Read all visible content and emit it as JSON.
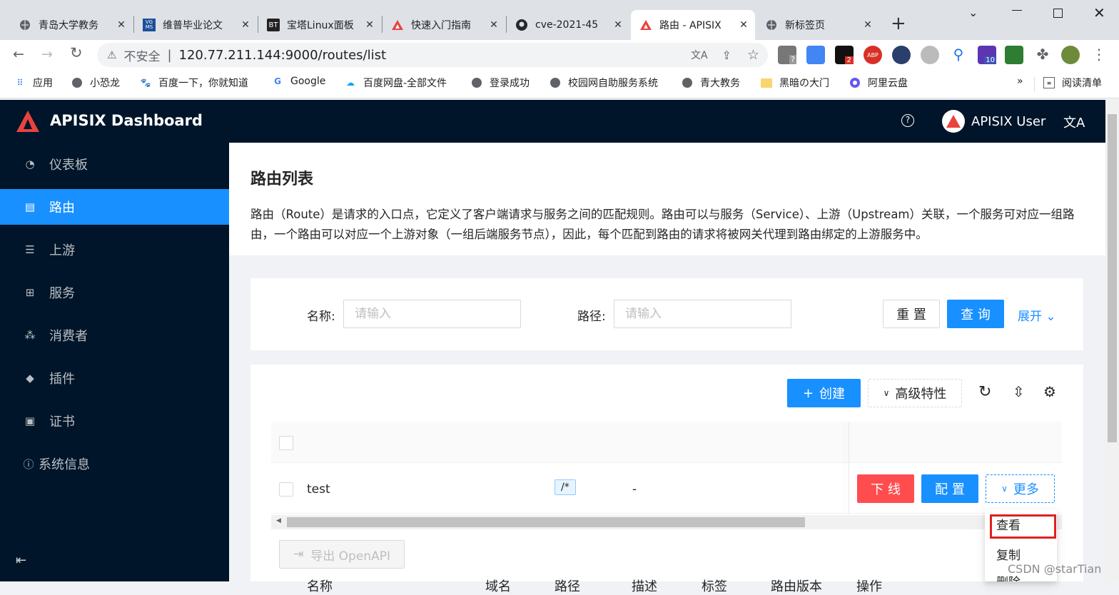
{
  "browser": {
    "tabs": [
      {
        "title": "青岛大学教务",
        "icon": "globe-icon"
      },
      {
        "title": "维普毕业论文",
        "icon": "vgms-icon"
      },
      {
        "title": "宝塔Linux面板",
        "icon": "bt-icon"
      },
      {
        "title": "快速入门指南",
        "icon": "apisix-icon"
      },
      {
        "title": "cve-2021-45",
        "icon": "github-icon"
      },
      {
        "title": "路由 - APISIX",
        "icon": "apisix-icon"
      },
      {
        "title": "新标签页",
        "icon": "globe-icon"
      }
    ],
    "active_tab": 5,
    "new_tab": "+",
    "address": {
      "insecure_label": "不安全",
      "url": "120.77.211.144:9000/routes/list"
    },
    "extension_badges": {
      "mail": "?",
      "ext2": "2",
      "abp": "ABP",
      "ext10": "10"
    },
    "bookmarks": [
      {
        "label": "应用",
        "icon": "apps-grid-icon"
      },
      {
        "label": "小恐龙",
        "icon": "globe-icon"
      },
      {
        "label": "百度一下，你就知道",
        "icon": "baidu-paw-icon"
      },
      {
        "label": "Google",
        "icon": "google-icon"
      },
      {
        "label": "百度网盘-全部文件",
        "icon": "cloud-icon"
      },
      {
        "label": "登录成功",
        "icon": "globe-icon"
      },
      {
        "label": "校园网自助服务系统",
        "icon": "globe-icon"
      },
      {
        "label": "青大教务",
        "icon": "globe-icon"
      },
      {
        "label": "黑暗の大门",
        "icon": "folder-icon"
      },
      {
        "label": "阿里云盘",
        "icon": "aliyun-icon"
      }
    ],
    "more_bookmarks": "»",
    "reading_list": "阅读清单"
  },
  "app": {
    "brand": "APISIX Dashboard",
    "user": "APISIX User",
    "colors": {
      "primary": "#1890ff",
      "header": "#001529",
      "danger": "#ff4d4f",
      "brand_red": "#e8433e"
    }
  },
  "sidebar": {
    "items": [
      {
        "label": "仪表板",
        "icon": "dashboard-icon"
      },
      {
        "label": "路由",
        "icon": "file-icon",
        "selected": true
      },
      {
        "label": "上游",
        "icon": "database-icon"
      },
      {
        "label": "服务",
        "icon": "appstore-icon"
      },
      {
        "label": "消费者",
        "icon": "cluster-icon"
      },
      {
        "label": "插件",
        "icon": "plugin-cube-icon"
      },
      {
        "label": "证书",
        "icon": "certificate-icon"
      },
      {
        "label": "系统信息",
        "icon": "info-circle-icon"
      }
    ],
    "collapse_icon": "menu-fold-icon"
  },
  "page": {
    "title": "路由列表",
    "description": "路由（Route）是请求的入口点，它定义了客户端请求与服务之间的匹配规则。路由可以与服务（Service）、上游（Upstream）关联，一个服务可对应一组路由，一个路由可以对应一个上游对象（一组后端服务节点），因此，每个匹配到路由的请求将被网关代理到路由绑定的上游服务中。"
  },
  "search": {
    "name_label": "名称:",
    "name_placeholder": "请输入",
    "path_label": "路径:",
    "path_placeholder": "请输入",
    "reset": "重 置",
    "query": "查 询",
    "expand": "展开"
  },
  "table_toolbar": {
    "create": "创建",
    "advanced": "高级特性"
  },
  "table": {
    "columns": [
      "名称",
      "域名",
      "路径",
      "描述",
      "标签",
      "路由版本",
      "操作"
    ],
    "rows": [
      {
        "name": "test",
        "host": "",
        "path": "/*",
        "desc": "-",
        "labels": "",
        "version": ""
      }
    ],
    "actions": {
      "offline": "下 线",
      "config": "配 置",
      "more": "更多"
    }
  },
  "dropdown": {
    "items": [
      "查看",
      "复制",
      "删除"
    ],
    "highlighted": 0
  },
  "export": "导出 OpenAPI",
  "watermark": "CSDN @starTian"
}
